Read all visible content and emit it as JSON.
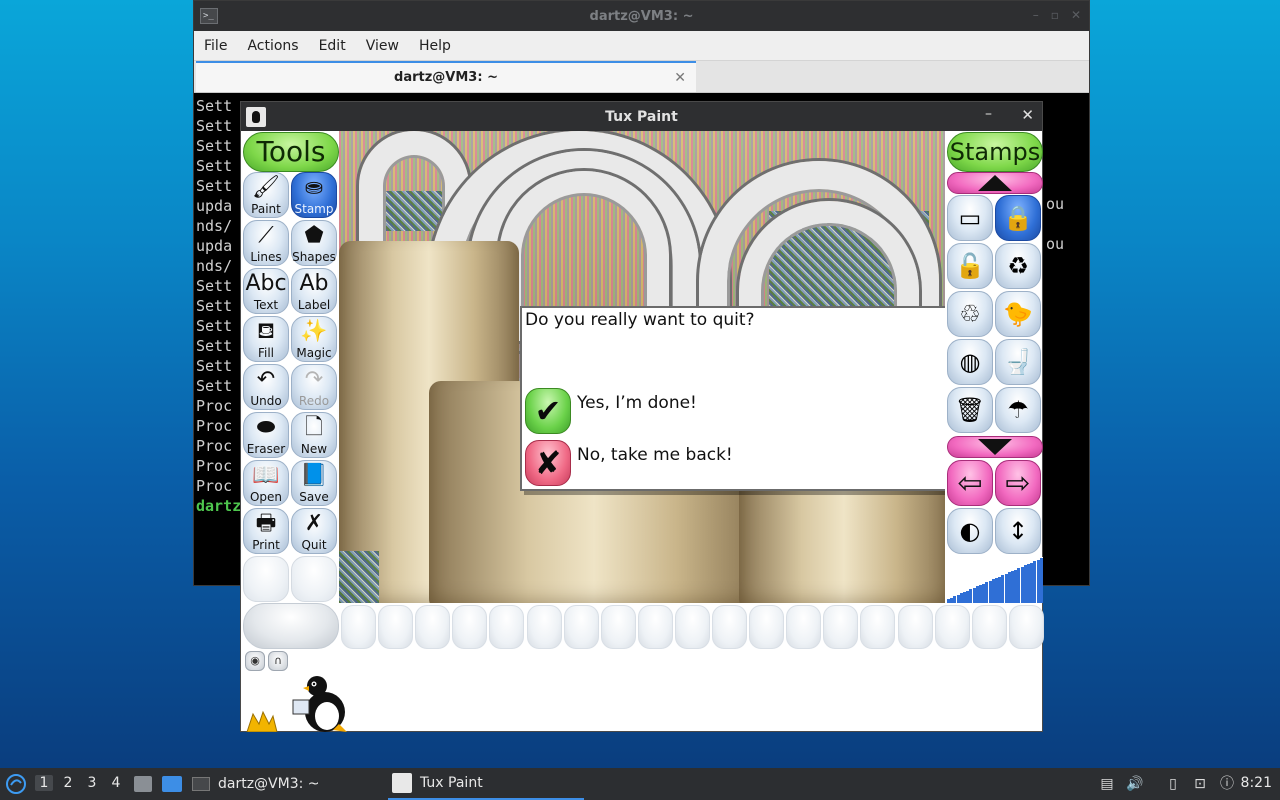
{
  "terminal": {
    "title": "dartz@VM3: ~",
    "menu": [
      "File",
      "Actions",
      "Edit",
      "View",
      "Help"
    ],
    "tab_label": "dartz@VM3: ~",
    "lines": [
      "Sett",
      "Sett",
      "Sett",
      "Sett",
      "Sett",
      "upda",
      "nds/",
      "upda",
      "nds/",
      "Sett",
      "Sett",
      "Sett",
      "Sett",
      "Sett",
      "Sett",
      "Proc",
      "Proc",
      "Proc",
      "Proc",
      "Proc",
      "dartz"
    ],
    "right_fragments": [
      "ou",
      "ou"
    ]
  },
  "tuxpaint": {
    "title": "Tux Paint",
    "tools_header": "Tools",
    "stamps_header": "Stamps",
    "tools": [
      {
        "label": "Paint",
        "icon": "paintbrush-icon",
        "glyph": "🖌",
        "active": false,
        "disabled": false
      },
      {
        "label": "Stamp",
        "icon": "stamp-icon",
        "glyph": "⛂",
        "active": true,
        "disabled": false
      },
      {
        "label": "Lines",
        "icon": "lines-icon",
        "glyph": "⟋",
        "active": false,
        "disabled": false
      },
      {
        "label": "Shapes",
        "icon": "pentagon-icon",
        "glyph": "⬟",
        "active": false,
        "disabled": false
      },
      {
        "label": "Text",
        "icon": "text-icon",
        "glyph": "Abc",
        "active": false,
        "disabled": false
      },
      {
        "label": "Label",
        "icon": "label-icon",
        "glyph": "Ab",
        "active": false,
        "disabled": false
      },
      {
        "label": "Fill",
        "icon": "fill-bucket-icon",
        "glyph": "⛾",
        "active": false,
        "disabled": false
      },
      {
        "label": "Magic",
        "icon": "magic-wand-icon",
        "glyph": "✨",
        "active": false,
        "disabled": false
      },
      {
        "label": "Undo",
        "icon": "undo-icon",
        "glyph": "↶",
        "active": false,
        "disabled": false
      },
      {
        "label": "Redo",
        "icon": "redo-icon",
        "glyph": "↷",
        "active": false,
        "disabled": true
      },
      {
        "label": "Eraser",
        "icon": "eraser-icon",
        "glyph": "⬬",
        "active": false,
        "disabled": false
      },
      {
        "label": "New",
        "icon": "new-page-icon",
        "glyph": "🗋",
        "active": false,
        "disabled": false
      },
      {
        "label": "Open",
        "icon": "open-book-icon",
        "glyph": "📖",
        "active": false,
        "disabled": false
      },
      {
        "label": "Save",
        "icon": "save-book-icon",
        "glyph": "📘",
        "active": false,
        "disabled": false
      },
      {
        "label": "Print",
        "icon": "printer-icon",
        "glyph": "🖶",
        "active": false,
        "disabled": false
      },
      {
        "label": "Quit",
        "icon": "quit-x-icon",
        "glyph": "✗",
        "active": false,
        "disabled": false
      }
    ],
    "dialog": {
      "question": "Do you really want to quit?",
      "yes_label": "Yes, I’m done!",
      "no_label": "No, take me back!",
      "yes_glyph": "✔",
      "no_glyph": "✘"
    },
    "stamps": [
      {
        "icon": "microwave-icon",
        "glyph": "▭",
        "active": false
      },
      {
        "icon": "padlock-icon",
        "glyph": "🔒",
        "active": true
      },
      {
        "icon": "open-padlock-icon",
        "glyph": "🔓",
        "active": false
      },
      {
        "icon": "recycle-bin-icon",
        "glyph": "♻",
        "active": false
      },
      {
        "icon": "recycle-box-icon",
        "glyph": "♲",
        "active": false
      },
      {
        "icon": "rubber-duck-icon",
        "glyph": "🐤",
        "active": false
      },
      {
        "icon": "tin-can-icon",
        "glyph": "◍",
        "active": false
      },
      {
        "icon": "toilet-icon",
        "glyph": "🚽",
        "active": false
      },
      {
        "icon": "trash-can-icon",
        "glyph": "🗑",
        "active": false
      },
      {
        "icon": "umbrella-icon",
        "glyph": "☂",
        "active": false
      }
    ],
    "arrows": {
      "left_glyph": "⇦",
      "right_glyph": "⇨"
    },
    "controls": {
      "sound_glyph": "◐",
      "flip_glyph": "↕"
    },
    "palette_count": 19,
    "colors": {
      "accent": "#2f6fd6",
      "header_green": "#7fd84a",
      "scroll_pink": "#f26ac0"
    }
  },
  "taskbar": {
    "workspaces": [
      "1",
      "2",
      "3",
      "4"
    ],
    "active_workspace": "1",
    "tasks": [
      {
        "label": "dartz@VM3: ~",
        "active": false
      },
      {
        "label": "Tux Paint",
        "active": true
      }
    ],
    "clock": "8:21"
  }
}
